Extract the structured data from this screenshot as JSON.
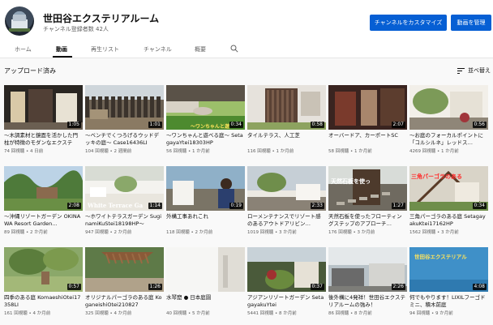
{
  "channel": {
    "name": "世田谷エクステリアルーム",
    "subscribers": "チャンネル登録者数 42人",
    "customize_label": "チャンネルをカスタマイズ",
    "manage_label": "動画を管理"
  },
  "tabs": [
    "ホーム",
    "動画",
    "再生リスト",
    "チャンネル",
    "概要"
  ],
  "active_tab": "動画",
  "section": {
    "title": "アップロード済み",
    "sort_label": "並べ替え"
  },
  "videos": [
    {
      "title": "〜木調素材と鏡面を活かした門柱が特徴のモダンなエクステ",
      "meta": "74 回視聴 • 4 日前",
      "duration": "1:05"
    },
    {
      "title": "〜ベンチでくつろげるウッドデッキの庭〜 Case16436LI",
      "meta": "104 回視聴 • 2 週間前",
      "duration": "1:01"
    },
    {
      "title": "〜ワンちゃんと遊べる庭〜 SetagayaYtei18303HP",
      "meta": "56 回視聴 • 1 か月前",
      "duration": "0:34",
      "overlay": "〜ワンちゃんと遊"
    },
    {
      "title": "タイルテラス、人工芝",
      "meta": "116 回視聴 • 1 か月前",
      "duration": "0:58"
    },
    {
      "title": "オーバードア、カーポートSC",
      "meta": "58 回視聴 • 1 か月前",
      "duration": "2:07"
    },
    {
      "title": "〜お庭のフォーカルポイントに「コルシルネ」レッドス…",
      "meta": "4269 回視聴 • 1 か月前",
      "duration": "0:56"
    },
    {
      "title": "〜沖縄リゾートガーデン OKINAWA Resort Garden…",
      "meta": "89 回視聴 • 2 か月前",
      "duration": "2:08"
    },
    {
      "title": "〜ホワイトテラスガーデン SuginamiKuStei18198HP〜",
      "meta": "947 回視聴 • 2 か月前",
      "duration": "1:14",
      "overlay": "White Terrace Ga"
    },
    {
      "title": "外構工事あれこれ",
      "meta": "118 回視聴 • 2 か月前",
      "duration": "0:19"
    },
    {
      "title": "ローメンテナンスでリゾート感のあるアウトドアリビン…",
      "meta": "1019 回視聴 • 3 か月前",
      "duration": "2:33"
    },
    {
      "title": "天然石板を使ったフローティングステップのアプローチ…",
      "meta": "176 回視聴 • 3 か月前",
      "duration": "1:27",
      "overlay": "天然石板を使っ"
    },
    {
      "title": "三角パーゴラのある庭 SetagayakuKtei17162HP",
      "meta": "1562 回視聴 • 3 か月前",
      "duration": "0:34",
      "overlay": "三角パーゴラのある"
    },
    {
      "title": "四季のある庭 KomaeshiOtei17358LI",
      "meta": "161 回視聴 • 4 か月前",
      "duration": "0:57"
    },
    {
      "title": "オリジナルパーゴラのある庭 KoganeishiOtei210827",
      "meta": "325 回視聴 • 4 か月前",
      "duration": "1:26"
    },
    {
      "title": "水琴窟 ● 日本庭園",
      "meta": "40 回視聴 • 5 か月前",
      "duration": ""
    },
    {
      "title": "アジアンリゾートガーデン SetagayakuYtei",
      "meta": "5441 回視聴 • 8 か月前",
      "duration": "0:37"
    },
    {
      "title": "後外構に4発祥！世田谷エクステリアルームの強み！",
      "meta": "86 回視聴 • 8 か月前",
      "duration": "2:26"
    },
    {
      "title": "何でもやります！LIXILフーゴドミニ、積木前庭",
      "meta": "94 回視聴 • 9 か月前",
      "duration": "4:08",
      "overlay": "世田谷エクステリアル"
    }
  ],
  "colors": {
    "accent": "#065fd4"
  }
}
